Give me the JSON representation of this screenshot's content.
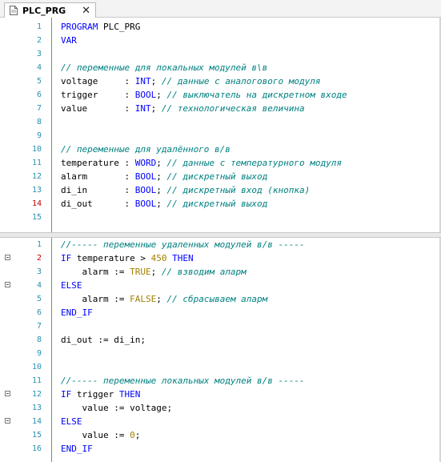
{
  "tab": {
    "title": "PLC_PRG",
    "close_glyph": "✕",
    "icon": "document-icon"
  },
  "declarations": [
    {
      "n": "1",
      "t": [
        [
          "PROGRAM ",
          "kw"
        ],
        [
          "PLC_PRG",
          ""
        ]
      ]
    },
    {
      "n": "2",
      "t": [
        [
          "VAR",
          "kw"
        ]
      ]
    },
    {
      "n": "3",
      "t": []
    },
    {
      "n": "4",
      "t": [
        [
          "// переменные для локальных модулей в\\в",
          "cm"
        ]
      ]
    },
    {
      "n": "5",
      "t": [
        [
          "voltage     : ",
          ""
        ],
        [
          "INT",
          "kw"
        ],
        [
          "; ",
          ""
        ],
        [
          "// данные с аналогового модуля",
          "cm"
        ]
      ]
    },
    {
      "n": "6",
      "t": [
        [
          "trigger     : ",
          ""
        ],
        [
          "BOOL",
          "kw"
        ],
        [
          "; ",
          ""
        ],
        [
          "// выключатель на дискретном входе",
          "cm"
        ]
      ]
    },
    {
      "n": "7",
      "t": [
        [
          "value       : ",
          ""
        ],
        [
          "INT",
          "kw"
        ],
        [
          "; ",
          ""
        ],
        [
          "// технологическая величина",
          "cm"
        ]
      ]
    },
    {
      "n": "8",
      "t": []
    },
    {
      "n": "9",
      "t": []
    },
    {
      "n": "10",
      "t": [
        [
          "// переменные для удалённого в/в",
          "cm"
        ]
      ]
    },
    {
      "n": "11",
      "t": [
        [
          "temperature : ",
          ""
        ],
        [
          "WORD",
          "kw"
        ],
        [
          "; ",
          ""
        ],
        [
          "// данные с температурного модуля",
          "cm"
        ]
      ]
    },
    {
      "n": "12",
      "t": [
        [
          "alarm       : ",
          ""
        ],
        [
          "BOOL",
          "kw"
        ],
        [
          "; ",
          ""
        ],
        [
          "// дискретный выход",
          "cm"
        ]
      ]
    },
    {
      "n": "13",
      "t": [
        [
          "di_in       : ",
          ""
        ],
        [
          "BOOL",
          "kw"
        ],
        [
          "; ",
          ""
        ],
        [
          "// дискретный вход (кнопка)",
          "cm"
        ]
      ]
    },
    {
      "n": "14",
      "err": true,
      "t": [
        [
          "di_out      : ",
          ""
        ],
        [
          "BOOL",
          "kw"
        ],
        [
          "; ",
          ""
        ],
        [
          "// дискретный выход",
          "cm"
        ]
      ]
    },
    {
      "n": "15",
      "t": []
    }
  ],
  "implementation": [
    {
      "n": "1",
      "t": [
        [
          "//----- переменные удаленных модулей в/в -----",
          "cm"
        ]
      ]
    },
    {
      "n": "2",
      "err": true,
      "fold": true,
      "t": [
        [
          "IF ",
          "kw"
        ],
        [
          "temperature > ",
          ""
        ],
        [
          "450",
          "lit"
        ],
        [
          " ",
          ""
        ],
        [
          "THEN",
          "kw"
        ]
      ]
    },
    {
      "n": "3",
      "t": [
        [
          "    alarm := ",
          ""
        ],
        [
          "TRUE",
          "lit"
        ],
        [
          "; ",
          ""
        ],
        [
          "// взводим аларм",
          "cm"
        ]
      ]
    },
    {
      "n": "4",
      "fold": true,
      "t": [
        [
          "ELSE",
          "kw"
        ]
      ]
    },
    {
      "n": "5",
      "t": [
        [
          "    alarm := ",
          ""
        ],
        [
          "FALSE",
          "lit"
        ],
        [
          "; ",
          ""
        ],
        [
          "// сбрасываем аларм",
          "cm"
        ]
      ]
    },
    {
      "n": "6",
      "t": [
        [
          "END_IF",
          "kw"
        ]
      ]
    },
    {
      "n": "7",
      "t": []
    },
    {
      "n": "8",
      "t": [
        [
          "di_out := di_in;",
          ""
        ]
      ]
    },
    {
      "n": "9",
      "t": []
    },
    {
      "n": "10",
      "t": []
    },
    {
      "n": "11",
      "t": [
        [
          "//----- переменные локальных модулей в/в -----",
          "cm"
        ]
      ]
    },
    {
      "n": "12",
      "fold": true,
      "t": [
        [
          "IF ",
          "kw"
        ],
        [
          "trigger ",
          ""
        ],
        [
          "THEN",
          "kw"
        ]
      ]
    },
    {
      "n": "13",
      "t": [
        [
          "    value := voltage;",
          ""
        ]
      ]
    },
    {
      "n": "14",
      "fold": true,
      "t": [
        [
          "ELSE",
          "kw"
        ]
      ]
    },
    {
      "n": "15",
      "t": [
        [
          "    value := ",
          ""
        ],
        [
          "0",
          "lit"
        ],
        [
          ";",
          ""
        ]
      ]
    },
    {
      "n": "16",
      "t": [
        [
          "END_IF",
          "kw"
        ]
      ]
    }
  ]
}
